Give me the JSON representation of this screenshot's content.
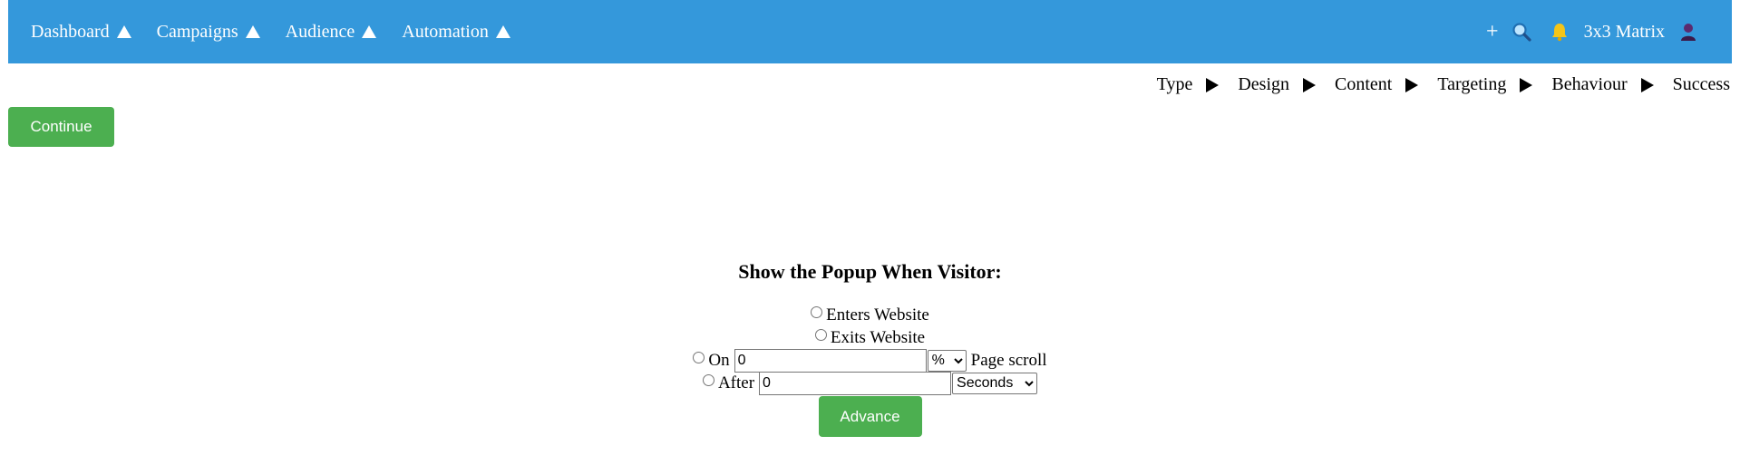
{
  "navbar": {
    "items": [
      {
        "label": "Dashboard"
      },
      {
        "label": "Campaigns"
      },
      {
        "label": "Audience"
      },
      {
        "label": "Automation"
      }
    ],
    "plus": "+",
    "account_name": "3x3 Matrix",
    "bg_color": "#3498db",
    "icons": [
      "plus-icon",
      "search-icon",
      "bell-icon",
      "user-icon"
    ]
  },
  "wizard": {
    "steps": [
      "Type",
      "Design",
      "Content",
      "Targeting",
      "Behaviour",
      "Success"
    ]
  },
  "continue_label": "Continue",
  "trigger": {
    "title": "Show the Popup When Visitor:",
    "enters_label": "Enters Website",
    "exits_label": "Exits Website",
    "on_label": "On",
    "scroll_value": "0",
    "scroll_unit": "%",
    "scroll_suffix": "Page scroll",
    "after_label": "After",
    "time_value": "0",
    "time_unit": "Seconds",
    "advance_label": "Advance"
  },
  "colors": {
    "accent_green": "#4caf50",
    "nav_blue": "#3498db",
    "bell_yellow": "#f5c518",
    "user_purple": "#5b2a6e"
  }
}
